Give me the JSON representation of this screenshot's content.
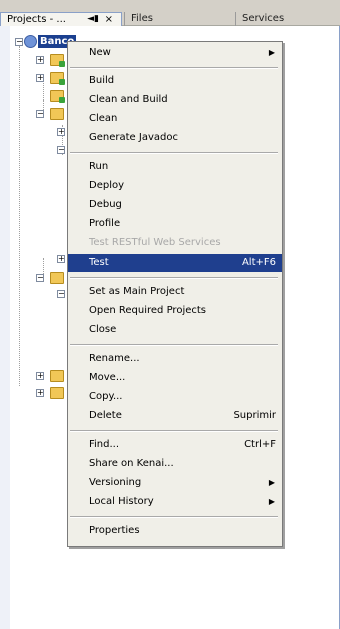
{
  "tabs": [
    {
      "label": "Projects - ...",
      "icon": "pin-icon",
      "close": "×"
    },
    {
      "label": "Files"
    },
    {
      "label": "Services"
    }
  ],
  "tree": {
    "root_label": "Banco"
  },
  "context_menu": {
    "items": [
      {
        "label": "New",
        "submenu": true
      },
      {
        "label": "Build"
      },
      {
        "label": "Clean and Build"
      },
      {
        "label": "Clean"
      },
      {
        "label": "Generate Javadoc"
      },
      {
        "label": "Run"
      },
      {
        "label": "Deploy"
      },
      {
        "label": "Debug"
      },
      {
        "label": "Profile"
      },
      {
        "label": "Test RESTful Web Services",
        "disabled": true
      },
      {
        "label": "Test",
        "accelerator": "Alt+F6",
        "highlighted": true
      },
      {
        "label": "Set as Main Project"
      },
      {
        "label": "Open Required Projects"
      },
      {
        "label": "Close"
      },
      {
        "label": "Rename..."
      },
      {
        "label": "Move..."
      },
      {
        "label": "Copy..."
      },
      {
        "label": "Delete",
        "accelerator": "Suprimir"
      },
      {
        "label": "Find...",
        "accelerator": "Ctrl+F"
      },
      {
        "label": "Share on Kenai..."
      },
      {
        "label": "Versioning",
        "submenu": true
      },
      {
        "label": "Local History",
        "submenu": true
      },
      {
        "label": "Properties"
      }
    ]
  },
  "colors": {
    "highlight": "#1f3f8e",
    "menu_bg": "#f0efe8",
    "tab_bar": "#d4d0c8"
  }
}
